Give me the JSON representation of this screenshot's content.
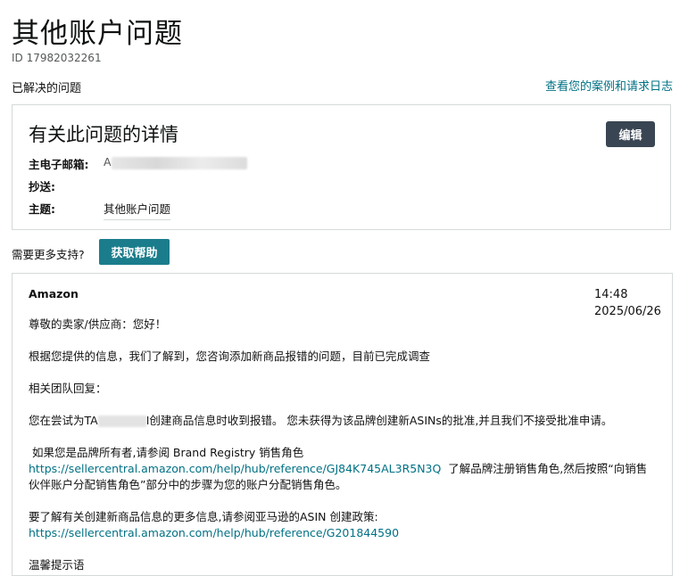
{
  "page": {
    "title": "其他账户问题",
    "case_id": "ID 17982032261",
    "status": "已解决的问题",
    "view_log_link": "查看您的案例和请求日志"
  },
  "details": {
    "heading": "有关此问题的详情",
    "edit_label": "编辑",
    "email_label": "主电子邮箱:",
    "email_value_prefix": "A",
    "cc_label": "抄送:",
    "subject_label": "主题:",
    "subject_value": "其他账户问题"
  },
  "help": {
    "prompt": "需要更多支持?",
    "button_label": "获取帮助"
  },
  "message": {
    "sender": "Amazon",
    "time": "14:48",
    "date": "2025/06/26",
    "greeting": "尊敬的卖家/供应商：您好！",
    "para1": "根据您提供的信息，我们了解到，您咨询添加新商品报错的问题，目前已完成调查",
    "para2": "相关团队回复：",
    "para3_a": "您在尝试为TA",
    "para3_b": "I创建商品信息时收到报错。 您未获得为该品牌创建新ASINs的批准,并且我们不接受批准申请。",
    "para4_a": " 如果您是品牌所有者,请参阅 Brand Registry 销售角色",
    "link1": "https://sellercentral.amazon.com/help/hub/reference/GJ84K745AL3R5N3Q",
    "para4_b": "  了解品牌注册销售角色,然后按照“向销售伙伴账户分配销售角色”部分中的步骤为您的账户分配销售角色。",
    "para5": "要了解有关创建新商品信息的更多信息,请参阅亚马逊的ASIN 创建政策:",
    "link2": "https://sellercentral.amazon.com/help/hub/reference/G201844590",
    "para6": "温馨提示语"
  }
}
